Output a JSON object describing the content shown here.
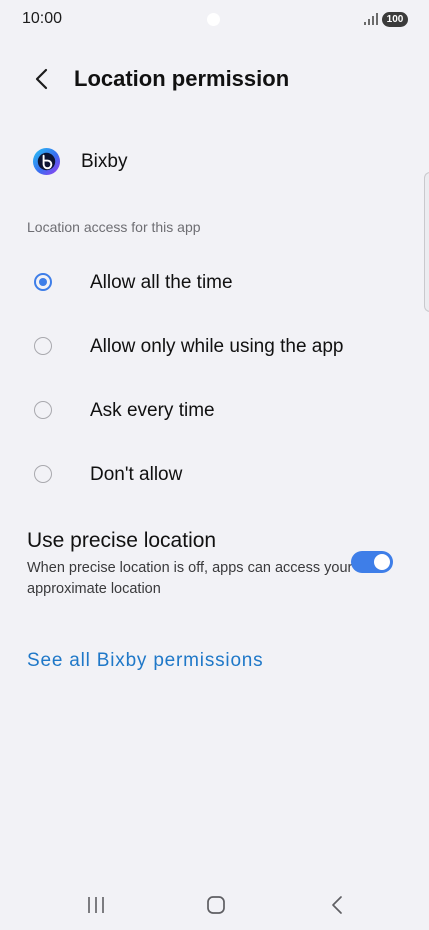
{
  "status_bar": {
    "time": "10:00",
    "battery": "100",
    "signal_icon": "signal-bars-icon"
  },
  "header": {
    "back_icon": "chevron-left-icon",
    "title": "Location permission"
  },
  "app": {
    "name": "Bixby",
    "icon": "bixby-app-icon"
  },
  "section_label": "Location access for this app",
  "options": [
    {
      "label": "Allow all the time",
      "selected": true
    },
    {
      "label": "Allow only while using the app",
      "selected": false
    },
    {
      "label": "Ask every time",
      "selected": false
    },
    {
      "label": "Don't allow",
      "selected": false
    }
  ],
  "precise_location": {
    "title": "Use precise location",
    "description": "When precise location is off, apps can access your approximate location",
    "enabled": true
  },
  "permissions_link": "See all Bixby permissions",
  "nav_bar": {
    "recents_icon": "recents-icon",
    "home_icon": "home-icon",
    "back_icon": "back-icon"
  },
  "colors": {
    "background": "#f2f2f6",
    "accent": "#3e7ee8",
    "link": "#1f78c8"
  }
}
